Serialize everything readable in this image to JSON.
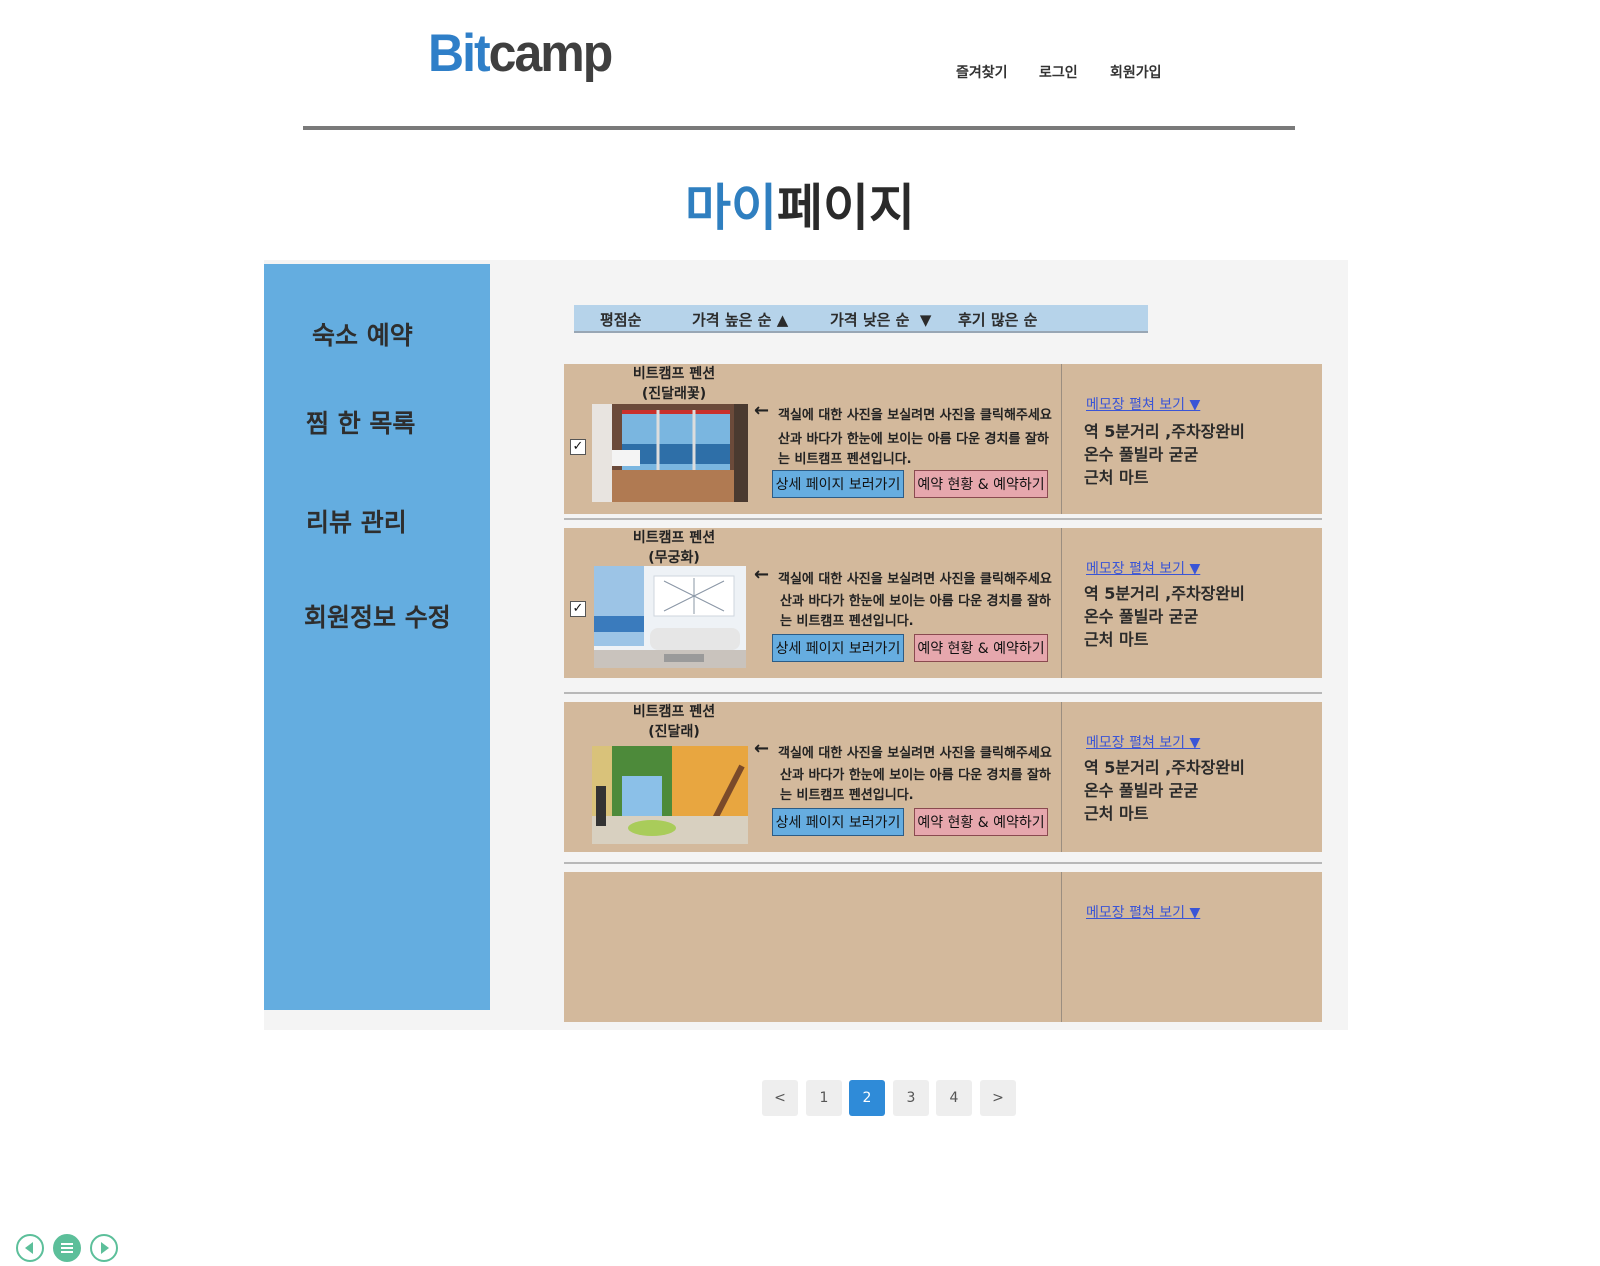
{
  "header": {
    "logo_part1": "Bit",
    "logo_part2": "camp",
    "nav": {
      "favorites": "즐겨찾기",
      "login": "로그인",
      "signup": "회원가입"
    }
  },
  "title": {
    "part1": "마이",
    "part2": "페이지"
  },
  "sidebar": {
    "items": [
      "숙소 예약",
      "찜 한 목록",
      "리뷰 관리",
      "회원정보 수정"
    ]
  },
  "sort": {
    "rating": "평점순",
    "price_high": "가격 높은 순",
    "price_low": "가격 낮은 순",
    "reviews": "후기 많은 순"
  },
  "cards": [
    {
      "name_line1": "비트캠프 펜션",
      "name_line2": "(진달래꽃)",
      "checked": "✓",
      "arrow": "←",
      "desc1": "객실에 대한 사진을 보실려면 사진을 클릭해주세요",
      "desc2": "산과 바다가 한눈에 보이는 아름 다운 경치를 잘하",
      "desc3": "는 비트캠프 펜션입니다.",
      "detail_btn": "상세 페이지 보러가기",
      "reserve_btn": "예약 현황 & 예약하기",
      "memo_link": "메모장 펼쳐 보기 ▼",
      "memo1": "역 5분거리 ,주차장완비",
      "memo2": "온수 풀빌라  굳굳",
      "memo3": "근처 마트"
    },
    {
      "name_line1": "비트캠프 펜션",
      "name_line2": "(무궁화)",
      "checked": "✓",
      "arrow": "←",
      "desc1": "객실에 대한 사진을 보실려면 사진을 클릭해주세요",
      "desc2": "산과 바다가 한눈에 보이는 아름 다운 경치를 잘하",
      "desc3": "는 비트캠프 펜션입니다.",
      "detail_btn": "상세 페이지 보러가기",
      "reserve_btn": "예약 현황 & 예약하기",
      "memo_link": "메모장 펼쳐 보기 ▼",
      "memo1": "역 5분거리 ,주차장완비",
      "memo2": "온수 풀빌라  굳굳",
      "memo3": "근처 마트"
    },
    {
      "name_line1": "비트캠프 펜션",
      "name_line2": "(진달래)",
      "arrow": "←",
      "desc1": "객실에 대한 사진을 보실려면 사진을 클릭해주세요",
      "desc2": "산과 바다가 한눈에 보이는 아름 다운 경치를 잘하",
      "desc3": "는 비트캠프 펜션입니다.",
      "detail_btn": "상세 페이지 보러가기",
      "reserve_btn": "예약 현황 & 예약하기",
      "memo_link": "메모장 펼쳐 보기 ▼",
      "memo1": "역 5분거리 ,주차장완비",
      "memo2": "온수 풀빌라  굳굳",
      "memo3": "근처 마트"
    },
    {
      "memo_link": "메모장 펼쳐 보기 ▼"
    }
  ],
  "pagination": {
    "prev": "<",
    "pages": [
      "1",
      "2",
      "3",
      "4"
    ],
    "active": "2",
    "next": ">"
  },
  "colors": {
    "accent": "#2f8bd8",
    "sidebar": "#64ade0",
    "card": "#d3b99c"
  }
}
